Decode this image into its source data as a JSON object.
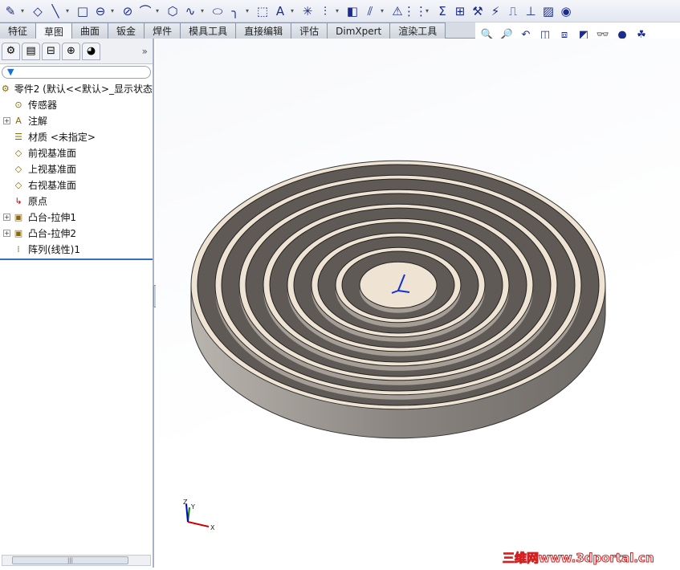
{
  "toolbar_top": {
    "icons": [
      "sketch-icon",
      "smart-dimension-icon",
      "line-icon",
      "rectangle-icon",
      "slot-icon",
      "circle-icon",
      "arc-icon",
      "polygon-icon",
      "spline-icon",
      "ellipse-icon",
      "fillet-icon",
      "construction-icon",
      "text-icon",
      "point-icon",
      "mirror-icon",
      "convert-icon",
      "offset-icon",
      "warning-icon",
      "pattern-icon",
      "sum-icon",
      "relations-icon",
      "repair-icon",
      "quick-snap-icon",
      "step-icon",
      "add-relation-icon",
      "image-icon",
      "record-icon"
    ]
  },
  "tabs": [
    {
      "label": "特征"
    },
    {
      "label": "草图",
      "active": true
    },
    {
      "label": "曲面"
    },
    {
      "label": "钣金"
    },
    {
      "label": "焊件"
    },
    {
      "label": "模具工具"
    },
    {
      "label": "直接编辑"
    },
    {
      "label": "评估"
    },
    {
      "label": "DimXpert"
    },
    {
      "label": "渲染工具"
    }
  ],
  "view_toolbar": {
    "icons": [
      "zoom-to-fit-icon",
      "zoom-area-icon",
      "previous-view-icon",
      "section-view-icon",
      "view-orientation-icon",
      "display-style-icon",
      "hide-show-icon",
      "appearance-icon",
      "scene-icon"
    ]
  },
  "sidebar": {
    "tabs": [
      "feature-manager-icon",
      "property-manager-icon",
      "configuration-manager-icon",
      "dimxpert-icon",
      "display-manager-icon"
    ],
    "more": "»",
    "filter_icon": "▼",
    "tree": [
      {
        "label": "零件2  (默认<<默认>_显示状态",
        "icon": "part-icon",
        "level": 0
      },
      {
        "label": "传感器",
        "icon": "sensor-icon",
        "level": 1
      },
      {
        "label": "注解",
        "icon": "annotation-icon",
        "level": 1,
        "expand": "+"
      },
      {
        "label": "材质 <未指定>",
        "icon": "material-icon",
        "level": 1
      },
      {
        "label": "前视基准面",
        "icon": "plane-icon",
        "level": 1
      },
      {
        "label": "上视基准面",
        "icon": "plane-icon",
        "level": 1
      },
      {
        "label": "右视基准面",
        "icon": "plane-icon",
        "level": 1
      },
      {
        "label": "原点",
        "icon": "origin-icon",
        "level": 1
      },
      {
        "label": "凸台-拉伸1",
        "icon": "extrude-icon",
        "level": 1,
        "expand": "+"
      },
      {
        "label": "凸台-拉伸2",
        "icon": "extrude-icon",
        "level": 1,
        "expand": "+"
      },
      {
        "label": "阵列(线性)1",
        "icon": "linear-pattern-icon",
        "level": 1
      }
    ]
  },
  "triad": {
    "x": "X",
    "y": "Y",
    "z": "Z"
  },
  "model": {
    "colors": {
      "top": "#efe4d4",
      "groove": "#5f5a55",
      "side": "#8a8580"
    },
    "grooves": 7
  },
  "watermark": "三维网www.3dportal.cn"
}
